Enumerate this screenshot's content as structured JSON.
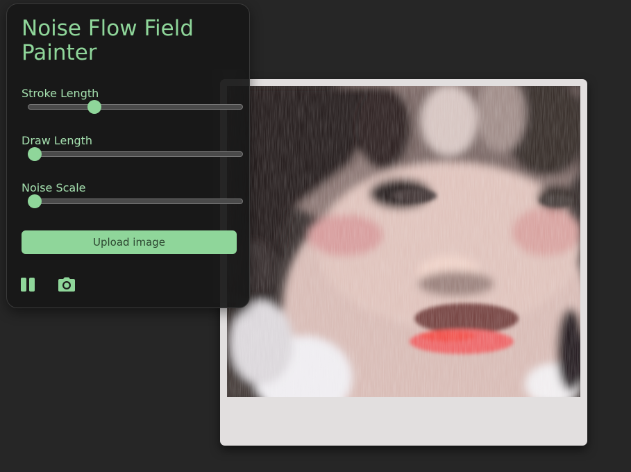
{
  "panel": {
    "title": "Noise Flow Field Painter",
    "sliders": [
      {
        "label": "Stroke Length",
        "value": 0.31
      },
      {
        "label": "Draw Length",
        "value": 0.03
      },
      {
        "label": "Noise Scale",
        "value": 0.03
      }
    ],
    "upload_label": "Upload image",
    "accent_color": "#8fd69a",
    "controls": [
      "pause-icon",
      "camera-icon"
    ]
  }
}
